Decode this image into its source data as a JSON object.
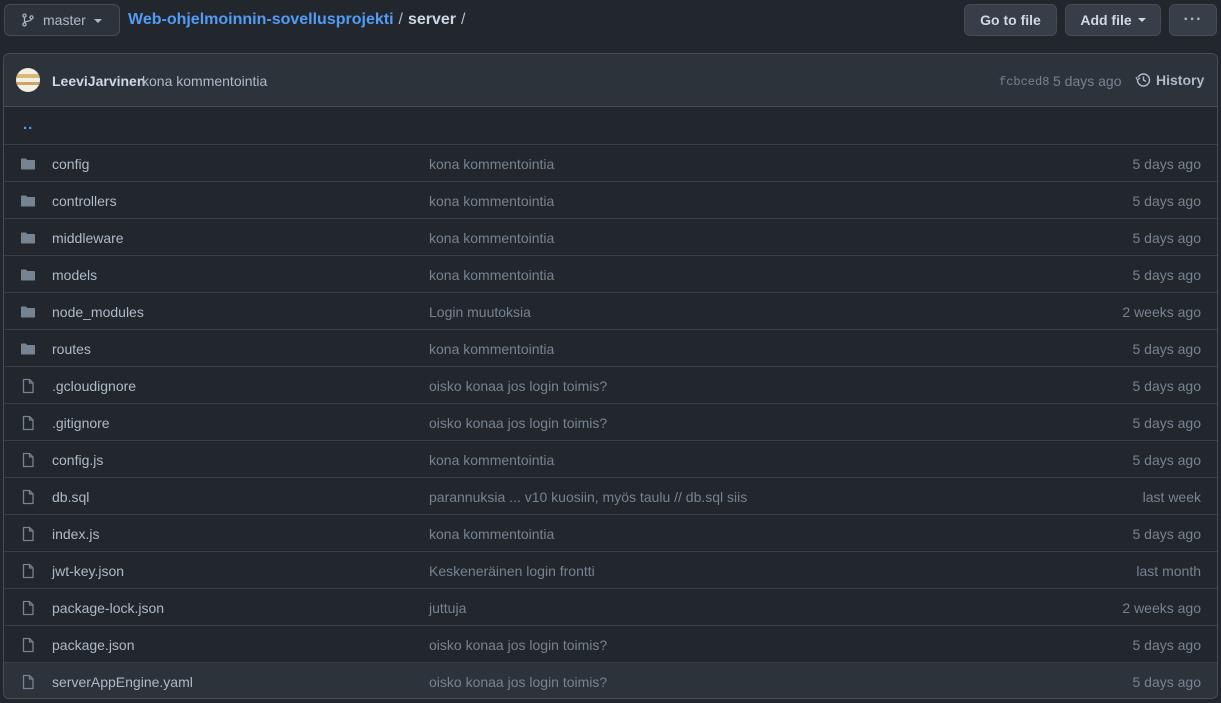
{
  "branch": {
    "label": "master",
    "icon": "git-branch-icon"
  },
  "breadcrumb": {
    "repo": "Web-ohjelmoinnin-sovellusprojekti",
    "separator": "/",
    "dir": "server",
    "trailing": "/"
  },
  "buttons": {
    "go_to_file": "Go to file",
    "add_file": "Add file",
    "more": "···"
  },
  "commit": {
    "user": "LeeviJarvinen",
    "message": "kona kommentointia",
    "sha": "fcbced8",
    "time": "5 days ago",
    "history_label": "History"
  },
  "files": {
    "updir": "..",
    "rows": [
      {
        "type": "folder",
        "name": "config",
        "message": "kona kommentointia",
        "age": "5 days ago"
      },
      {
        "type": "folder",
        "name": "controllers",
        "message": "kona kommentointia",
        "age": "5 days ago"
      },
      {
        "type": "folder",
        "name": "middleware",
        "message": "kona kommentointia",
        "age": "5 days ago"
      },
      {
        "type": "folder",
        "name": "models",
        "message": "kona kommentointia",
        "age": "5 days ago"
      },
      {
        "type": "folder",
        "name": "node_modules",
        "message": "Login muutoksia",
        "age": "2 weeks ago"
      },
      {
        "type": "folder",
        "name": "routes",
        "message": "kona kommentointia",
        "age": "5 days ago"
      },
      {
        "type": "file",
        "name": ".gcloudignore",
        "message": "oisko konaa jos login toimis?",
        "age": "5 days ago"
      },
      {
        "type": "file",
        "name": ".gitignore",
        "message": "oisko konaa jos login toimis?",
        "age": "5 days ago"
      },
      {
        "type": "file",
        "name": "config.js",
        "message": "kona kommentointia",
        "age": "5 days ago"
      },
      {
        "type": "file",
        "name": "db.sql",
        "message": "parannuksia ... v10 kuosiin, myös taulu // db.sql siis",
        "age": "last week"
      },
      {
        "type": "file",
        "name": "index.js",
        "message": "kona kommentointia",
        "age": "5 days ago"
      },
      {
        "type": "file",
        "name": "jwt-key.json",
        "message": "Keskeneräinen login frontti",
        "age": "last month"
      },
      {
        "type": "file",
        "name": "package-lock.json",
        "message": "juttuja",
        "age": "2 weeks ago"
      },
      {
        "type": "file",
        "name": "package.json",
        "message": "oisko konaa jos login toimis?",
        "age": "5 days ago"
      },
      {
        "type": "file",
        "name": "serverAppEngine.yaml",
        "message": "oisko konaa jos login toimis?",
        "age": "5 days ago"
      }
    ]
  },
  "colors": {
    "background": "#22272e",
    "link": "#539bf5",
    "muted": "#768390",
    "border": "#444c56"
  }
}
